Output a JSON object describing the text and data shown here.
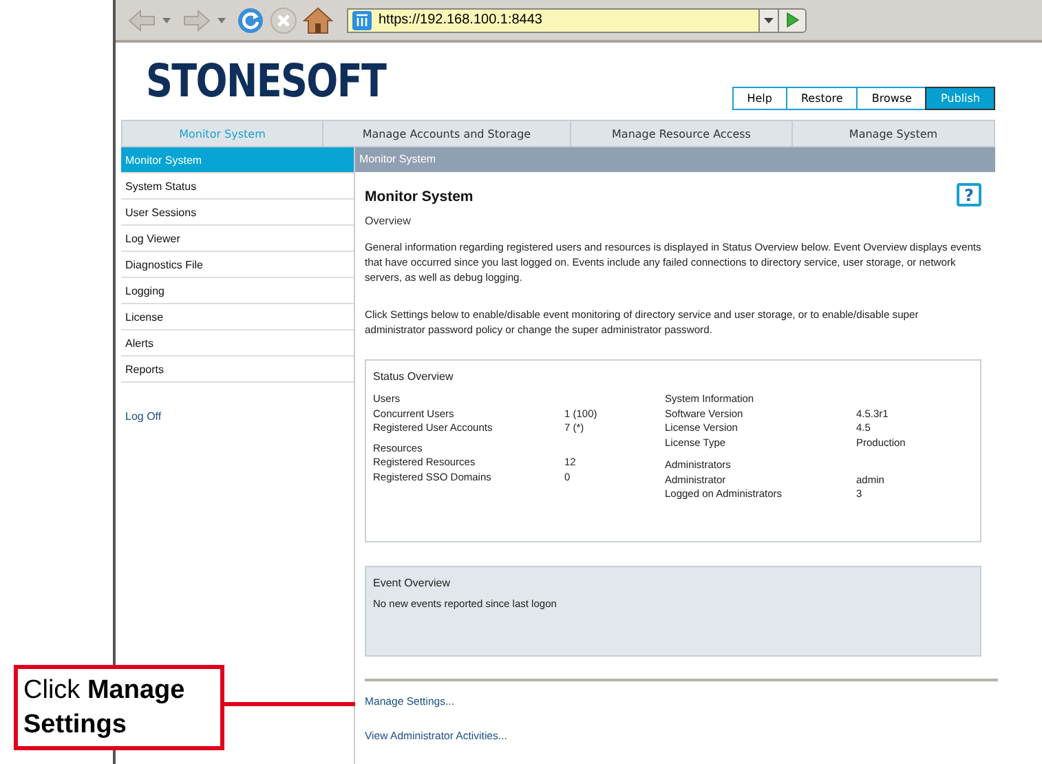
{
  "browser": {
    "address": "https://192.168.100.1:8443"
  },
  "logo": "STONESOFT",
  "header_buttons": [
    {
      "label": "Help",
      "selected": false
    },
    {
      "label": "Restore",
      "selected": false
    },
    {
      "label": "Browse",
      "selected": false
    },
    {
      "label": "Publish",
      "selected": true
    }
  ],
  "tabs": [
    {
      "label": "Monitor System",
      "selected": true
    },
    {
      "label": "Manage Accounts and Storage",
      "selected": false
    },
    {
      "label": "Manage Resource Access",
      "selected": false
    },
    {
      "label": "Manage System",
      "selected": false
    }
  ],
  "sidebar": {
    "items": [
      {
        "label": "Monitor System",
        "selected": true
      },
      {
        "label": "System Status",
        "selected": false
      },
      {
        "label": "User Sessions",
        "selected": false
      },
      {
        "label": "Log Viewer",
        "selected": false
      },
      {
        "label": "Diagnostics File",
        "selected": false
      },
      {
        "label": "Logging",
        "selected": false
      },
      {
        "label": "License",
        "selected": false
      },
      {
        "label": "Alerts",
        "selected": false
      },
      {
        "label": "Reports",
        "selected": false
      }
    ],
    "logoff": "Log Off"
  },
  "breadcrumb": "Monitor System",
  "content": {
    "title": "Monitor System",
    "help": "?",
    "subtitle": "Overview",
    "paragraphs": [
      "General information regarding registered users and resources is displayed in Status Overview below. Event Overview displays events that have occurred since you last logged on. Events include any failed connections to directory service, user storage, or network servers, as well as debug logging.",
      "Click Settings below to enable/disable event monitoring of directory service and user storage, or to enable/disable super administrator password policy or change the super administrator password."
    ],
    "status_overview": {
      "title": "Status Overview",
      "columns": [
        [
          {
            "heading": "Users",
            "rows": [
              {
                "label": "Concurrent Users",
                "value": "1 (100)"
              },
              {
                "label": "Registered User Accounts",
                "value": "7 (*)"
              }
            ]
          },
          {
            "heading": "Resources",
            "rows": [
              {
                "label": "Registered Resources",
                "value": "12"
              },
              {
                "label": "Registered SSO Domains",
                "value": "0"
              }
            ]
          }
        ],
        [
          {
            "heading": "System Information",
            "rows": [
              {
                "label": "Software Version",
                "value": "4.5.3r1"
              },
              {
                "label": "License Version",
                "value": "4.5"
              },
              {
                "label": "License Type",
                "value": "Production"
              }
            ]
          },
          {
            "heading": "Administrators",
            "rows": [
              {
                "label": "Administrator",
                "value": "admin"
              },
              {
                "label": "Logged on Administrators",
                "value": "3"
              }
            ]
          }
        ]
      ]
    },
    "event_overview": {
      "title": "Event Overview",
      "message": "No new events reported since last logon"
    },
    "links": [
      "Manage Settings...",
      "View Administrator Activities..."
    ]
  },
  "callout": "Click **Manage Settings**"
}
